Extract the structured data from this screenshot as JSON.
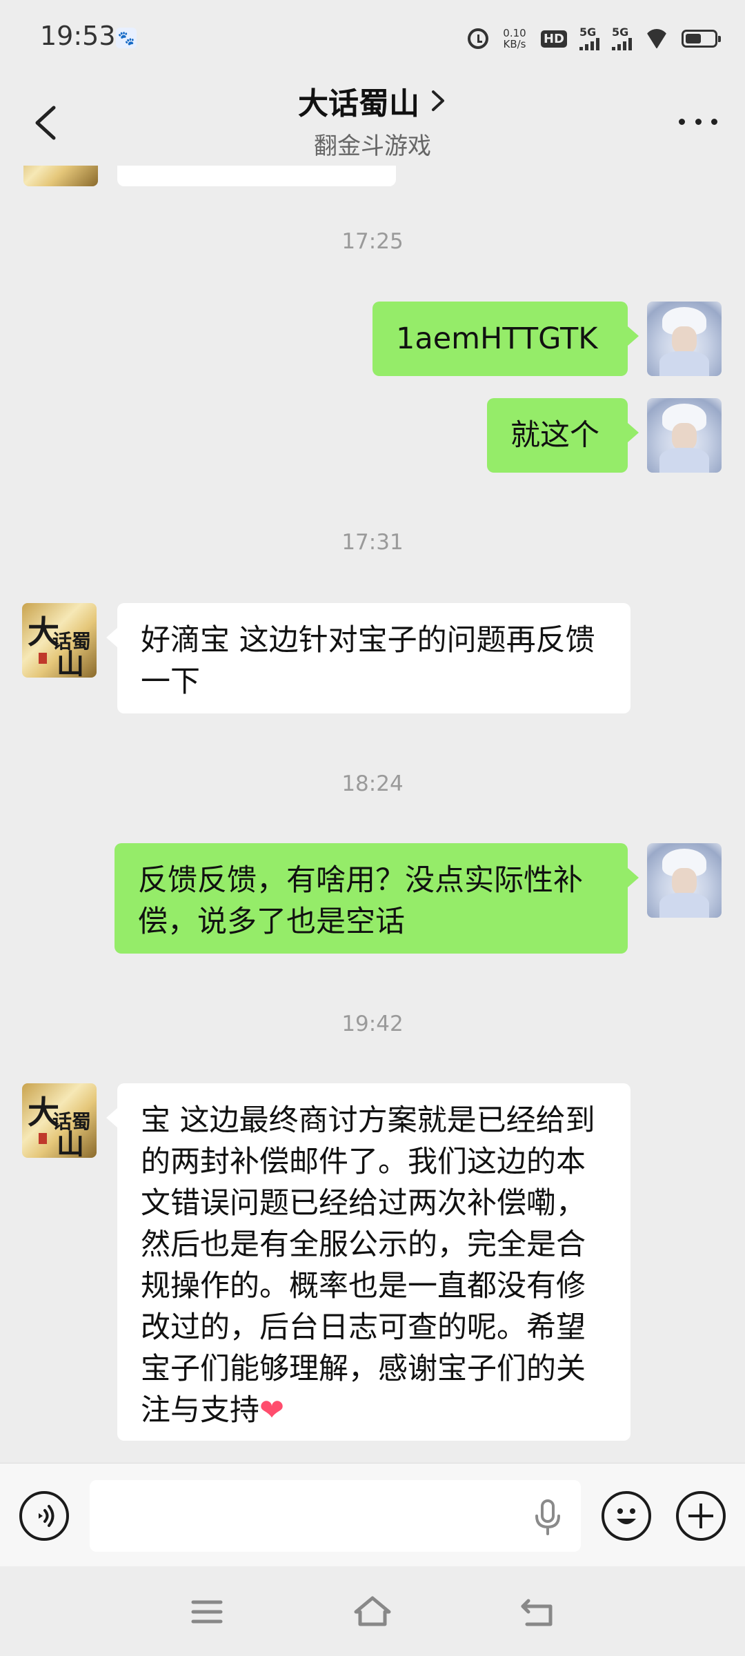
{
  "status_bar": {
    "time": "19:53",
    "net_speed_value": "0.10",
    "net_speed_unit": "KB/s",
    "hd": "HD",
    "sim1": "5G",
    "sim2": "5G",
    "battery_level": 0.55,
    "icons": [
      "baidu-icon",
      "alarm-icon",
      "hd-icon",
      "signal-icon",
      "signal-icon",
      "wifi-icon",
      "battery-icon"
    ]
  },
  "header": {
    "title": "大话蜀山",
    "subtitle": "翻金斗游戏"
  },
  "messages": [
    {
      "type": "timestamp",
      "text": "17:25"
    },
    {
      "type": "message",
      "side": "right",
      "text": "1aemHTTGTK"
    },
    {
      "type": "message",
      "side": "right",
      "text": "就这个"
    },
    {
      "type": "timestamp",
      "text": "17:31"
    },
    {
      "type": "message",
      "side": "left",
      "text": "好滴宝 这边针对宝子的问题再反馈一下"
    },
    {
      "type": "timestamp",
      "text": "18:24"
    },
    {
      "type": "message",
      "side": "right",
      "text": "反馈反馈，有啥用？没点实际性补偿，说多了也是空话"
    },
    {
      "type": "timestamp",
      "text": "19:42"
    },
    {
      "type": "message",
      "side": "left",
      "text": "宝 这边最终商讨方案就是已经给到的两封补偿邮件了。我们这边的本文错误问题已经给过两次补偿嘞，然后也是有全服公示的，完全是合规操作的。概率也是一直都没有修改过的，后台日志可查的呢。希望宝子们能够理解，感谢宝子们的关注与支持",
      "emoji": "❤"
    }
  ],
  "input_bar": {
    "value": "",
    "placeholder": ""
  },
  "colors": {
    "background": "#ededed",
    "outgoing_bubble": "#95ec69",
    "incoming_bubble": "#ffffff"
  }
}
